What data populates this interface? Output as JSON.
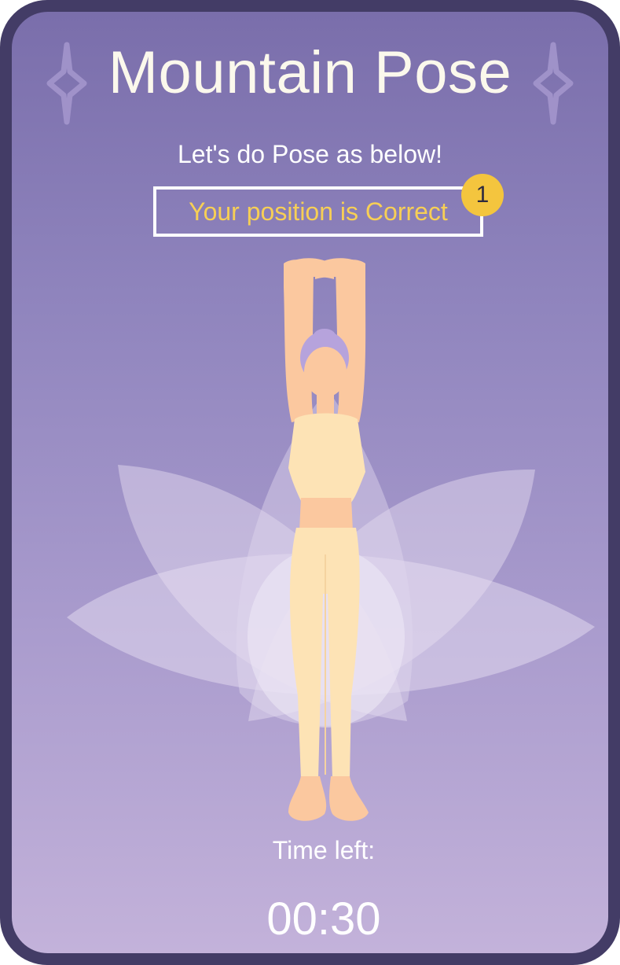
{
  "header": {
    "title": "Mountain Pose",
    "sparkle_icon": "sparkle-icon"
  },
  "instruction": "Let's do Pose as below!",
  "status": {
    "message": "Your position is Correct",
    "badge": "1",
    "highlight_color": "#f7cf55",
    "badge_color": "#f4c53e"
  },
  "illustration": {
    "icon": "yoga-mountain-pose-figure",
    "background": "lotus-petals"
  },
  "timer": {
    "label": "Time left:",
    "value": "00:30"
  },
  "colors": {
    "frame": "#433c66",
    "gradient_top": "#7a6eab",
    "gradient_bottom": "#c3b2da",
    "skin": "#fbc89f",
    "outfit": "#fde3b5"
  }
}
